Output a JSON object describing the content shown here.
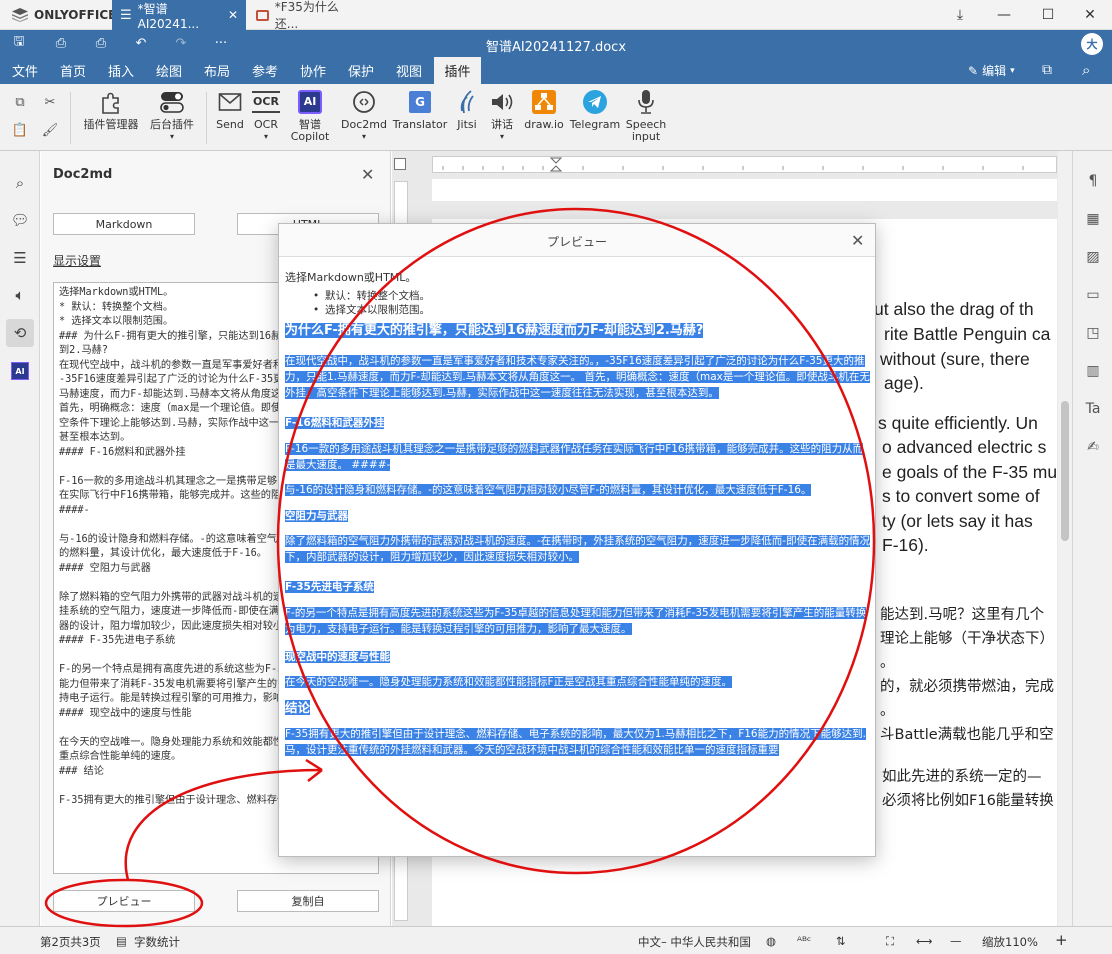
{
  "app": {
    "logo": "ONLYOFFICE",
    "tabs": [
      {
        "label": "*智谱AI20241..."
      },
      {
        "label": "*F35为什么还..."
      }
    ],
    "doc_title": "智谱AI20241127.docx",
    "avatar": "大"
  },
  "menu": {
    "items": [
      "文件",
      "首页",
      "插入",
      "绘图",
      "布局",
      "参考",
      "协作",
      "保护",
      "视图",
      "插件"
    ],
    "active": "插件",
    "edit_mode": "编辑"
  },
  "toolbar": {
    "buttons": [
      {
        "label": "插件管理器",
        "icon": "puzzle-icon"
      },
      {
        "label": "后台插件",
        "icon": "toggle-icon"
      },
      {
        "label": "Send",
        "icon": "mail-icon"
      },
      {
        "label": "OCR",
        "icon": "ocr-icon"
      },
      {
        "label": "智谱 Copilot",
        "icon": "ai-icon"
      },
      {
        "label": "Doc2md",
        "icon": "doc2md-icon"
      },
      {
        "label": "Translator",
        "icon": "translate-icon"
      },
      {
        "label": "Jitsi",
        "icon": "jitsi-icon"
      },
      {
        "label": "讲话",
        "icon": "speaker-icon"
      },
      {
        "label": "draw.io",
        "icon": "drawio-icon"
      },
      {
        "label": "Telegram",
        "icon": "telegram-icon"
      },
      {
        "label": "Speech input",
        "icon": "microphone-icon"
      }
    ],
    "ocr_glyph": "OCR",
    "ai_glyph": "AI",
    "translator_glyph": "G"
  },
  "panel": {
    "title": "Doc2md",
    "markdown_button": "Markdown",
    "html_button": "HTML",
    "display_settings": "显示设置",
    "markdown_text": "选择Markdown或HTML。\n* 默认：转换整个文档。\n* 选择文本以限制范围。\n### 为什么F-拥有更大的推引擎，只能达到16赫速度而力F-却能达到2.马赫?\n在现代空战中，战斗机的参数一直是军事爱好者和技术专家关注的。，-35F16速度差异引起了广泛的讨论为什么F-35更大的推力，只能1.马赫速度，而力F-却能达到.马赫本文将从角度这一。\n首先，明确概念：速度（max是一个理论值。即使战斗机在无外挂、高空条件下理论上能够达到.马赫，实际作战中这一速度往往无法实现，甚至根本达到。\n#### F-16燃料和武器外挂\n\nF-16一款的多用途战斗机其理念之一是携带足够的燃料武器作战任务在实际飞行中F16携带箱，能够完成并。这些的阻力从而是最大速度。\n####-\n\n与-16的设计隐身和燃料存储。-的这意味着空气阻力相对较小尽管F-的燃料量，其设计优化，最大速度低于F-16。\n#### 空阻力与武器\n\n除了燃料箱的空气阻力外携带的武器对战斗机的速度。-在携带时，外挂系统的空气阻力，速度进一步降低而-即使在满载的情况下，内部武器的设计，阻力增加较少，因此速度损失相对较小。\n#### F-35先进电子系统\n\nF-的另一个特点是拥有高度先进的系统这些为F-35卓越的信息处理和能力但带来了消耗F-35发电机需要将引擎产生的能量转换为电力，支持电子运行。能是转换过程引擎的可用推力，影响了最大速度。\n#### 现空战中的速度与性能\n\n在今天的空战唯一。隐身处理能力系统和效能都性能指标F正是空战其重点综合性能单纯的速度。\n### 结论\n\nF-35拥有更大的推引擎但由于设计理念、燃料存储、电子系统",
    "preview_button": "プレビュー",
    "copy_button": "复制自"
  },
  "document": {
    "en_lines": [
      "ut also the drag of th",
      "rite Battle Penguin ca",
      "without (sure, there",
      "age).",
      "s quite efficiently. Un",
      "o advanced electric s",
      "e goals of the F-35 mu",
      "s to convert some of",
      "ty (or lets say it has",
      "F-16)."
    ],
    "cn_lines": [
      "能达到.马呢？这里有几个",
      "理论上能够（干净状态下）",
      "。",
      "的，就必须携带燃油，完成",
      "。",
      "斗Battle满载也能几乎和空",
      "如此先进的系统一定的—",
      "必须将比例如F16能量转换"
    ]
  },
  "dialog": {
    "title": "プレビュー",
    "intro": "选择Markdown或HTML。",
    "list": [
      "默认：转换整个文档。",
      "选择文本以限制范围。"
    ],
    "h2": "为什么F-拥有更大的推引擎，只能达到16赫速度而力F-却能达到2.马赫?",
    "p1": "在现代空战中，战斗机的参数一直是军事爱好者和技术专家关注的。，-35F16速度差异引起了广泛的讨论为什么F-35更大的推力，只能1.马赫速度，而力F-却能达到.马赫本文将从角度这一。 首先，明确概念：速度（max是一个理论值。即使战斗机在无外挂、高空条件下理论上能够达到.马赫，实际作战中这一速度往往无法实现，甚至根本达到。",
    "h4_1": "F-16燃料和武器外挂",
    "p2": "F-16一款的多用途战斗机其理念之一是携带足够的燃料武器作战任务在实际飞行中F16携带箱，能够完成并。这些的阻力从而是最大速度。 ####-",
    "p3": "与-16的设计隐身和燃料存储。-的这意味着空气阻力相对较小尽管F-的燃料量，其设计优化，最大速度低于F-16。",
    "h4_2": "空阻力与武器",
    "p4": "除了燃料箱的空气阻力外携带的武器对战斗机的速度。-在携带时，外挂系统的空气阻力，速度进一步降低而-即使在满载的情况下，内部武器的设计，阻力增加较少，因此速度损失相对较小。",
    "h4_3": "F-35先进电子系统",
    "p5": "F-的另一个特点是拥有高度先进的系统这些为F-35卓越的信息处理和能力但带来了消耗F-35发电机需要将引擎产生的能量转换为电力，支持电子运行。能是转换过程引擎的可用推力，影响了最大速度。",
    "h4_4": "现空战中的速度与性能",
    "p6": "在今天的空战唯一。隐身处理能力系统和效能都性能指标F正是空战其重点综合性能单纯的速度。",
    "h3": "结论",
    "p7": "F-35拥有更大的推引擎但由于设计理念、燃料存储、电子系统的影响，最大仅为1.马赫相比之下，F16能力的情况下能够达到.马，设计更注重传统的外挂燃料和武器。今天的空战环境中战斗机的综合性能和效能比单一的速度指标重要"
  },
  "status": {
    "page": "第2页共3页",
    "word_count": "字数统计",
    "language": "中文– 中华人民共和国",
    "zoom": "缩放110%"
  },
  "annotation": {
    "color": "#e01010"
  }
}
